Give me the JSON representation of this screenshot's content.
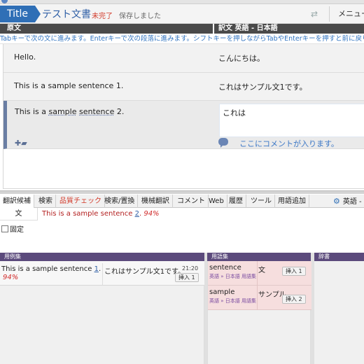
{
  "header": {
    "title": "Title",
    "document_name": "テスト文書",
    "status": "未完了",
    "save_status": "保存しました",
    "menu_label": "メニュー"
  },
  "columns": {
    "source": "原文",
    "target": "訳文 英語 - 日本語"
  },
  "hint": "Tabキーで次の文に進みます。Enterキーで次の段落に進みます。シフトキーを押しながらTabやEnterキーを押すと前に戻ります。",
  "segments": [
    {
      "source": "Hello.",
      "target": "こんにちは。"
    },
    {
      "source": "This is a sample sentence 1.",
      "target": "これはサンプル文1です。"
    },
    {
      "source_prefix": "This is a ",
      "source_term1": "sample",
      "source_mid": " ",
      "source_term2": "sentence",
      "source_suffix": " 2.",
      "target": "これは"
    }
  ],
  "comment": "ここにコメントが入ります。",
  "tabs": [
    {
      "label": "翻訳候補"
    },
    {
      "label": "検索"
    },
    {
      "label": "品質チェック"
    },
    {
      "label": "検索/置換"
    },
    {
      "label": "機械翻訳"
    },
    {
      "label": "コメント"
    },
    {
      "label": "Web"
    },
    {
      "label": "履歴"
    },
    {
      "label": "ツール"
    },
    {
      "label": "用語追加"
    }
  ],
  "language_selector": "英語 -",
  "candidates": {
    "type_label": "文",
    "sentence_prefix": "This is a sample sentence ",
    "sentence_number": "2",
    "sentence_suffix": ".",
    "match": "94%",
    "fix_label": "固定"
  },
  "panels": {
    "examples": "用例集",
    "glossary": "用語集",
    "dictionary": "辞書"
  },
  "examples": [
    {
      "source_prefix": "This is a sample sentence ",
      "number": "1",
      "source_suffix": ".",
      "match": "94%",
      "target": "これはサンプル文1です。",
      "time": "21:20",
      "insert_label": "挿入 1"
    }
  ],
  "glossary": [
    {
      "source": "sentence",
      "path": "英語 » 日本語 用語集",
      "target": "文",
      "insert_label": "挿入 1"
    },
    {
      "source": "sample",
      "path": "英語 » 日本語 用語集",
      "target": "サンプル",
      "insert_label": "挿入 2"
    }
  ],
  "colors": {
    "accent": "#2f6fb6",
    "panel_header": "#5b4a7c",
    "warning": "#d23a2a",
    "term_background": "#f6dede"
  }
}
